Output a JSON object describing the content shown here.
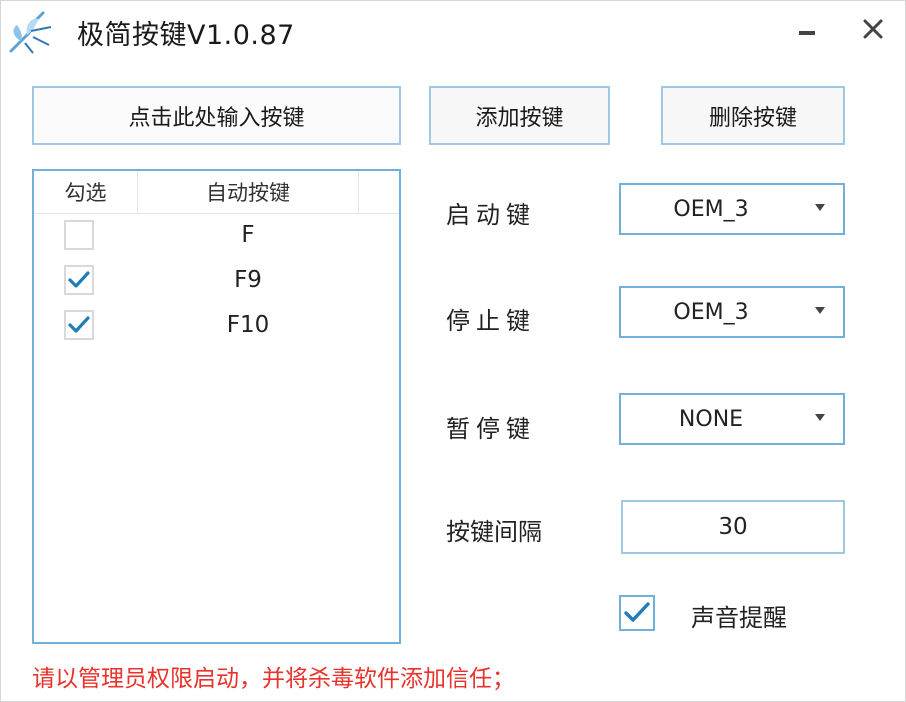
{
  "window": {
    "title": "极简按键V1.0.87",
    "accent": "#6fb1da",
    "warning_color": "#e8322b",
    "check_color": "#1f7db8"
  },
  "toolbar": {
    "input_button_label": "点击此处输入按键",
    "add_button_label": "添加按键",
    "delete_button_label": "删除按键"
  },
  "key_list": {
    "headers": [
      "勾选",
      "自动按键"
    ],
    "rows": [
      {
        "checked": false,
        "key": "F"
      },
      {
        "checked": true,
        "key": "F9"
      },
      {
        "checked": true,
        "key": "F10"
      }
    ]
  },
  "settings": {
    "start_key_label": "启动键",
    "start_key_value": "OEM_3",
    "stop_key_label": "停止键",
    "stop_key_value": "OEM_3",
    "pause_key_label": "暂停键",
    "pause_key_value": "NONE",
    "interval_label": "按键间隔",
    "interval_value": "30",
    "sound_label": "声音提醒",
    "sound_checked": true
  },
  "footer": {
    "warning": "请以管理员权限启动，并将杀毒软件添加信任；"
  },
  "icons": {
    "app": "mosquito-logo-icon",
    "minimize": "minimize-icon",
    "close": "close-icon",
    "dropdown": "chevron-down-icon",
    "check": "checkmark-icon"
  }
}
